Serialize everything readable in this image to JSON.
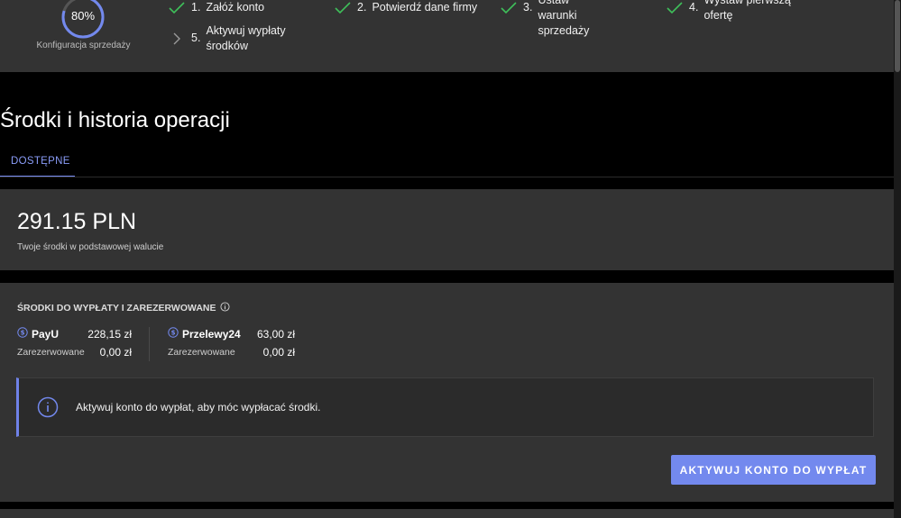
{
  "progress": {
    "percent_label": "80%",
    "percent": 80,
    "caption": "Konfiguracja sprzedaży",
    "steps": [
      {
        "num": "1.",
        "label": "Załóż konto",
        "done": true
      },
      {
        "num": "2.",
        "label": "Potwierdź dane firmy",
        "done": true
      },
      {
        "num": "3.",
        "label": "Ustaw warunki sprzedaży",
        "done": true
      },
      {
        "num": "4.",
        "label": "Wystaw pierwszą ofertę",
        "done": true
      },
      {
        "num": "5.",
        "label": "Aktywuj wypłaty środków",
        "done": false
      }
    ]
  },
  "page": {
    "title": "Środki i historia operacji",
    "tab_label": "DOSTĘPNE"
  },
  "balance": {
    "amount": "291.15 PLN",
    "caption": "Twoje środki w podstawowej walucie"
  },
  "payout": {
    "title": "ŚRODKI DO WYPŁATY I ZAREZERWOWANE",
    "providers": [
      {
        "name": "PayU",
        "amount": "228,15 zł",
        "reserved_label": "Zarezerwowane",
        "reserved_amount": "0,00 zł"
      },
      {
        "name": "Przelewy24",
        "amount": "63,00 zł",
        "reserved_label": "Zarezerwowane",
        "reserved_amount": "0,00 zł"
      }
    ],
    "alert_text": "Aktywuj konto do wypłat, aby móc wypłacać środki.",
    "button_label": "AKTYWUJ KONTO DO WYPŁAT"
  },
  "colors": {
    "accent": "#7389ee",
    "check": "#3fbf5a",
    "panel": "#333333",
    "background": "#000000"
  }
}
